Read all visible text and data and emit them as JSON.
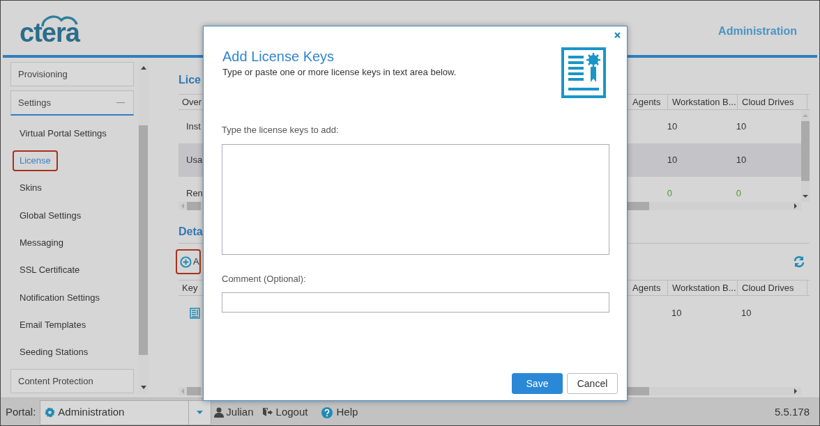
{
  "header": {
    "logo": "ctera",
    "section_title": "Administration"
  },
  "sidebar": {
    "groups": [
      {
        "label": "Provisioning",
        "expanded": false
      },
      {
        "label": "Settings",
        "expanded": true,
        "children": [
          {
            "label": "Virtual Portal Settings",
            "selected": false,
            "callout": false
          },
          {
            "label": "License",
            "selected": true,
            "callout": true
          },
          {
            "label": "Skins",
            "selected": false,
            "callout": false
          },
          {
            "label": "Global Settings",
            "selected": false,
            "callout": false
          },
          {
            "label": "Messaging",
            "selected": false,
            "callout": false
          },
          {
            "label": "SSL Certificate",
            "selected": false,
            "callout": false
          },
          {
            "label": "Notification Settings",
            "selected": false,
            "callout": false
          },
          {
            "label": "Email Templates",
            "selected": false,
            "callout": false
          },
          {
            "label": "Seeding Stations",
            "selected": false,
            "callout": false
          }
        ]
      },
      {
        "label": "Content Protection",
        "expanded": false
      }
    ]
  },
  "licenses": {
    "title": "Lice",
    "columns": [
      "Over",
      "Agents",
      "Workstation B...",
      "Cloud Drives"
    ],
    "rows": [
      {
        "cells": [
          "Inst",
          "",
          "10",
          "10"
        ],
        "selected": false,
        "color": "#333333"
      },
      {
        "cells": [
          "Usa",
          "",
          "10",
          "10"
        ],
        "selected": true,
        "color": "#333333"
      },
      {
        "cells": [
          "Ren",
          "",
          "0",
          "0"
        ],
        "selected": false,
        "color": "#4a9a2e"
      }
    ]
  },
  "details": {
    "title": "Deta",
    "add_button": {
      "label": "A",
      "callout": true
    },
    "columns": [
      "Key",
      "Agents",
      "Workstation B...",
      "Cloud Drives"
    ],
    "rows": [
      {
        "cells": [
          "",
          "",
          "10",
          "10"
        ]
      }
    ]
  },
  "footer": {
    "portal_label": "Portal:",
    "portal": "Administration",
    "user": "Julian",
    "logout": "Logout",
    "help": "Help",
    "version": "5.5.178"
  },
  "dialog": {
    "title": "Add License Keys",
    "subtitle": "Type or paste one or more license keys in text area below.",
    "keys_label": "Type the license keys to add:",
    "comment_label": "Comment (Optional):",
    "buttons": [
      {
        "label": "Save",
        "kind": "primary"
      },
      {
        "label": "Cancel",
        "kind": "secondary"
      }
    ]
  }
}
